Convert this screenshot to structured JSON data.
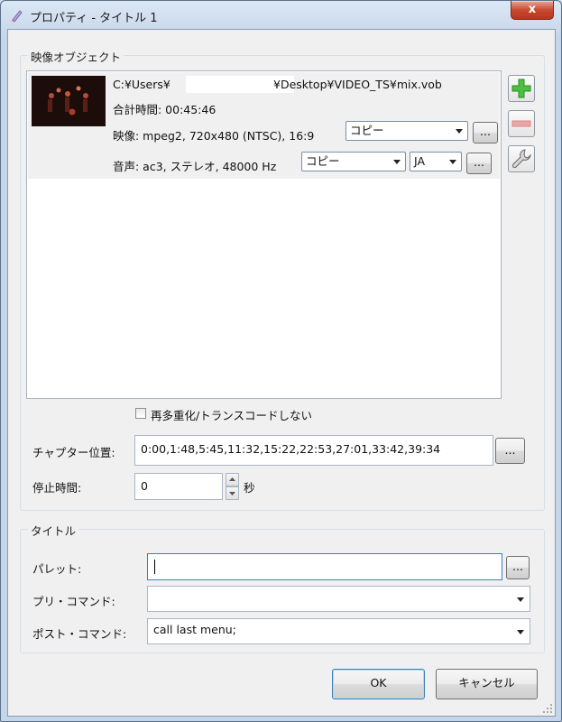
{
  "window": {
    "title": "プロパティ - タイトル 1",
    "close_glyph": "x"
  },
  "video_group": {
    "title": "映像オブジェクト",
    "item": {
      "path_prefix": "C:¥Users¥",
      "path_suffix": "¥Desktop¥VIDEO_TS¥mix.vob",
      "duration": "合計時間: 00:45:46",
      "video_info": "映像: mpeg2, 720x480 (NTSC), 16:9",
      "video_mode": "コピー",
      "audio_info": "音声: ac3, ステレオ, 48000 Hz",
      "audio_mode": "コピー",
      "audio_lang": "JA",
      "more_label": "..."
    },
    "no_reencode_label": "再多重化/トランスコードしない",
    "chapter_label": "チャプター位置:",
    "chapter_value": "0:00,1:48,5:45,11:32,15:22,22:53,27:01,33:42,39:34",
    "pause_label": "停止時間:",
    "pause_value": "0",
    "pause_unit": "秒"
  },
  "title_group": {
    "title": "タイトル",
    "palette_label": "パレット:",
    "palette_value": "",
    "pre_command_label": "プリ・コマンド:",
    "pre_command_value": "",
    "post_command_label": "ポスト・コマンド:",
    "post_command_value": "call last menu;"
  },
  "buttons": {
    "ok": "OK",
    "cancel": "キャンセル"
  },
  "colors": {
    "add": "#3fb23a",
    "remove": "#e8a0a0",
    "accent": "#3d7bd0"
  }
}
